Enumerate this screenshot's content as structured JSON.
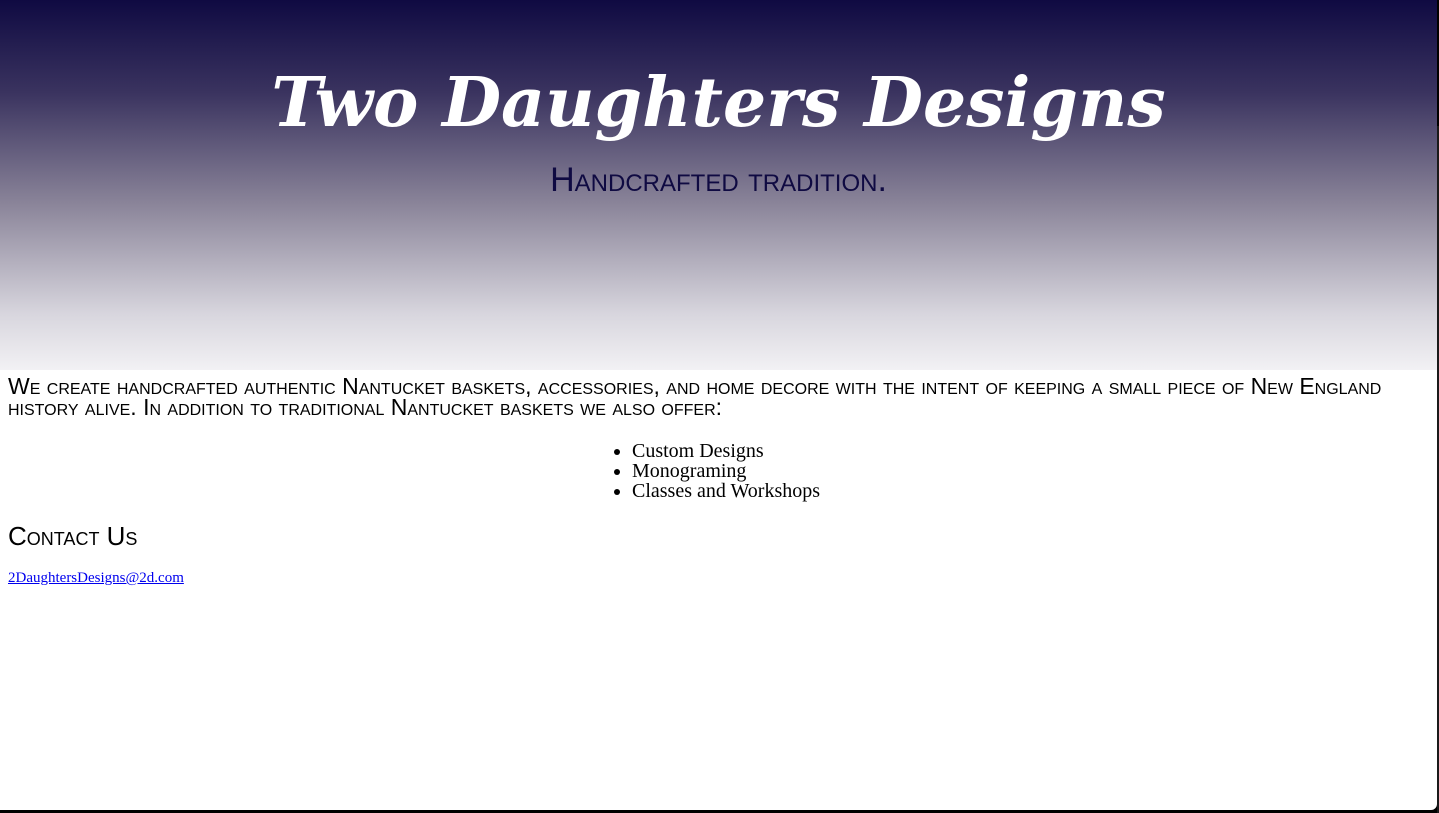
{
  "header": {
    "title": "Two Daughters Designs",
    "tagline": "Handcrafted tradition."
  },
  "intro": {
    "text": "We create handcrafted authentic Nantucket baskets, accessories, and home decore with the intent of keeping a small piece of New England history alive. In addition to traditional Nantucket baskets we also offer:"
  },
  "offerings": [
    "Custom Designs",
    "Monograming",
    "Classes and Workshops"
  ],
  "contact": {
    "heading": "Contact Us",
    "email": "2DaughtersDesigns@2d.com"
  },
  "colors": {
    "header_dark": "#0f0a42",
    "header_light": "#f2f1f4",
    "title_text": "#ffffff",
    "tagline_text": "#0f0a42",
    "link": "#0000ee"
  }
}
